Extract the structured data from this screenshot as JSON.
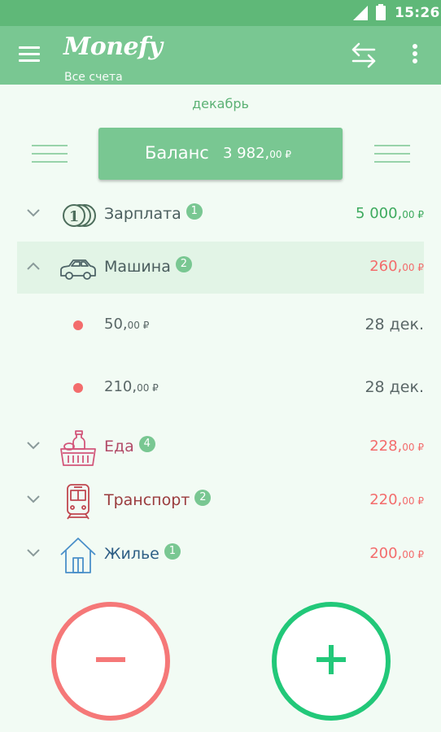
{
  "status": {
    "time": "15:26"
  },
  "header": {
    "app_name": "Monefy",
    "subtitle": "Все счета"
  },
  "period": {
    "label": "декабрь"
  },
  "balance": {
    "label": "Баланс",
    "amount": "3 982,",
    "cents": "00 ₽"
  },
  "categories": [
    {
      "name": "Зарплата",
      "count": "1",
      "amount": "5 000,",
      "cents": "00 ₽",
      "icon": "coins-icon",
      "type": "income"
    },
    {
      "name": "Машина",
      "count": "2",
      "amount": "260,",
      "cents": "00 ₽",
      "icon": "car-icon",
      "type": "expense",
      "expanded": true
    },
    {
      "name": "Еда",
      "count": "4",
      "amount": "228,",
      "cents": "00 ₽",
      "icon": "food-basket-icon",
      "type": "expense"
    },
    {
      "name": "Транспорт",
      "count": "2",
      "amount": "220,",
      "cents": "00 ₽",
      "icon": "train-icon",
      "type": "expense"
    },
    {
      "name": "Жилье",
      "count": "1",
      "amount": "200,",
      "cents": "00 ₽",
      "icon": "house-icon",
      "type": "expense"
    }
  ],
  "transactions": [
    {
      "amount": "50,",
      "cents": "00 ₽",
      "date": "28 дек."
    },
    {
      "amount": "210,",
      "cents": "00 ₽",
      "date": "28 дек."
    }
  ],
  "actions": {
    "expense": "minus-icon",
    "income": "plus-icon"
  },
  "colors": {
    "primary": "#79c792",
    "income": "#3daa5e",
    "expense": "#f36c6c",
    "fab_income": "#22c879",
    "fab_expense": "#f57878"
  }
}
